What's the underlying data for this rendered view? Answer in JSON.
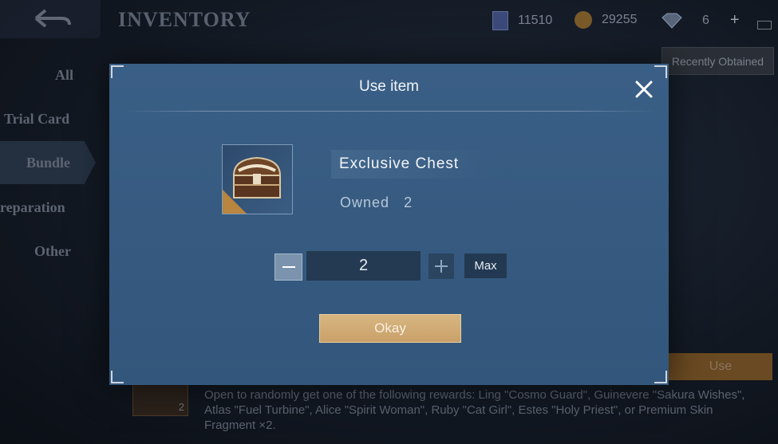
{
  "header": {
    "title": "INVENTORY",
    "currencies": [
      {
        "icon": "ticket-icon",
        "value": "11510"
      },
      {
        "icon": "coin-icon",
        "value": "29255"
      },
      {
        "icon": "diamond-icon",
        "value": "6"
      }
    ],
    "recently_obtained_label": "Recently Obtained"
  },
  "categories": [
    {
      "label": "All"
    },
    {
      "label": "Trial Card"
    },
    {
      "label": "Bundle"
    },
    {
      "label": "reparation"
    },
    {
      "label": "Other"
    }
  ],
  "background": {
    "use_label": "Use",
    "item_count": "2",
    "description": "Open to randomly get one of the following rewards: Ling \"Cosmo Guard\", Guinevere \"Sakura Wishes\", Atlas \"Fuel Turbine\", Alice \"Spirit Woman\", Ruby \"Cat Girl\", Estes \"Holy Priest\", or Premium Skin Fragment ×2."
  },
  "modal": {
    "title": "Use item",
    "item_icon": "treasure-chest-icon",
    "item_name": "Exclusive Chest",
    "owned_label": "Owned",
    "owned_count": "2",
    "quantity": "2",
    "max_label": "Max",
    "okay_label": "Okay"
  },
  "colors": {
    "modal_bg": "#365a80",
    "okay_button": "#d0ab74",
    "accent_gold": "#b9853f"
  }
}
